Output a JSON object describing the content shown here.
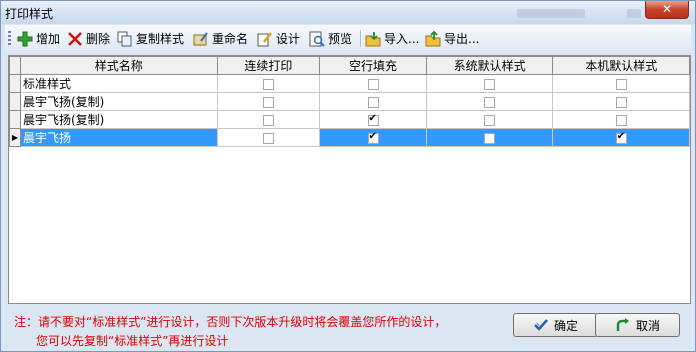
{
  "window": {
    "title": "打印样式",
    "close_label": "✕"
  },
  "toolbar": {
    "add": "增加",
    "delete": "删除",
    "copy_style": "复制样式",
    "rename": "重命名",
    "design": "设计",
    "preview": "预览",
    "import": "导入...",
    "export": "导出..."
  },
  "grid": {
    "columns": [
      "样式名称",
      "连续打印",
      "空行填充",
      "系统默认样式",
      "本机默认样式"
    ],
    "rows": [
      {
        "name": "标准样式",
        "continuous": false,
        "fill_blank": false,
        "system_default": false,
        "local_default": false
      },
      {
        "name": "晨宇飞扬(复制)",
        "continuous": false,
        "fill_blank": false,
        "system_default": false,
        "local_default": false
      },
      {
        "name": "晨宇飞扬(复制)",
        "continuous": false,
        "fill_blank": true,
        "system_default": false,
        "local_default": false
      },
      {
        "name": "晨宇飞扬",
        "continuous": false,
        "fill_blank": true,
        "system_default": false,
        "local_default": true,
        "selected": true
      }
    ],
    "current_row_marker": "▶"
  },
  "note": {
    "line1": "注：请不要对“标准样式”进行设计，否则下次版本升级时将会覆盖您所作的设计，",
    "line2": "您可以先复制“标准样式”再进行设计"
  },
  "buttons": {
    "ok": "确定",
    "cancel": "取消"
  }
}
